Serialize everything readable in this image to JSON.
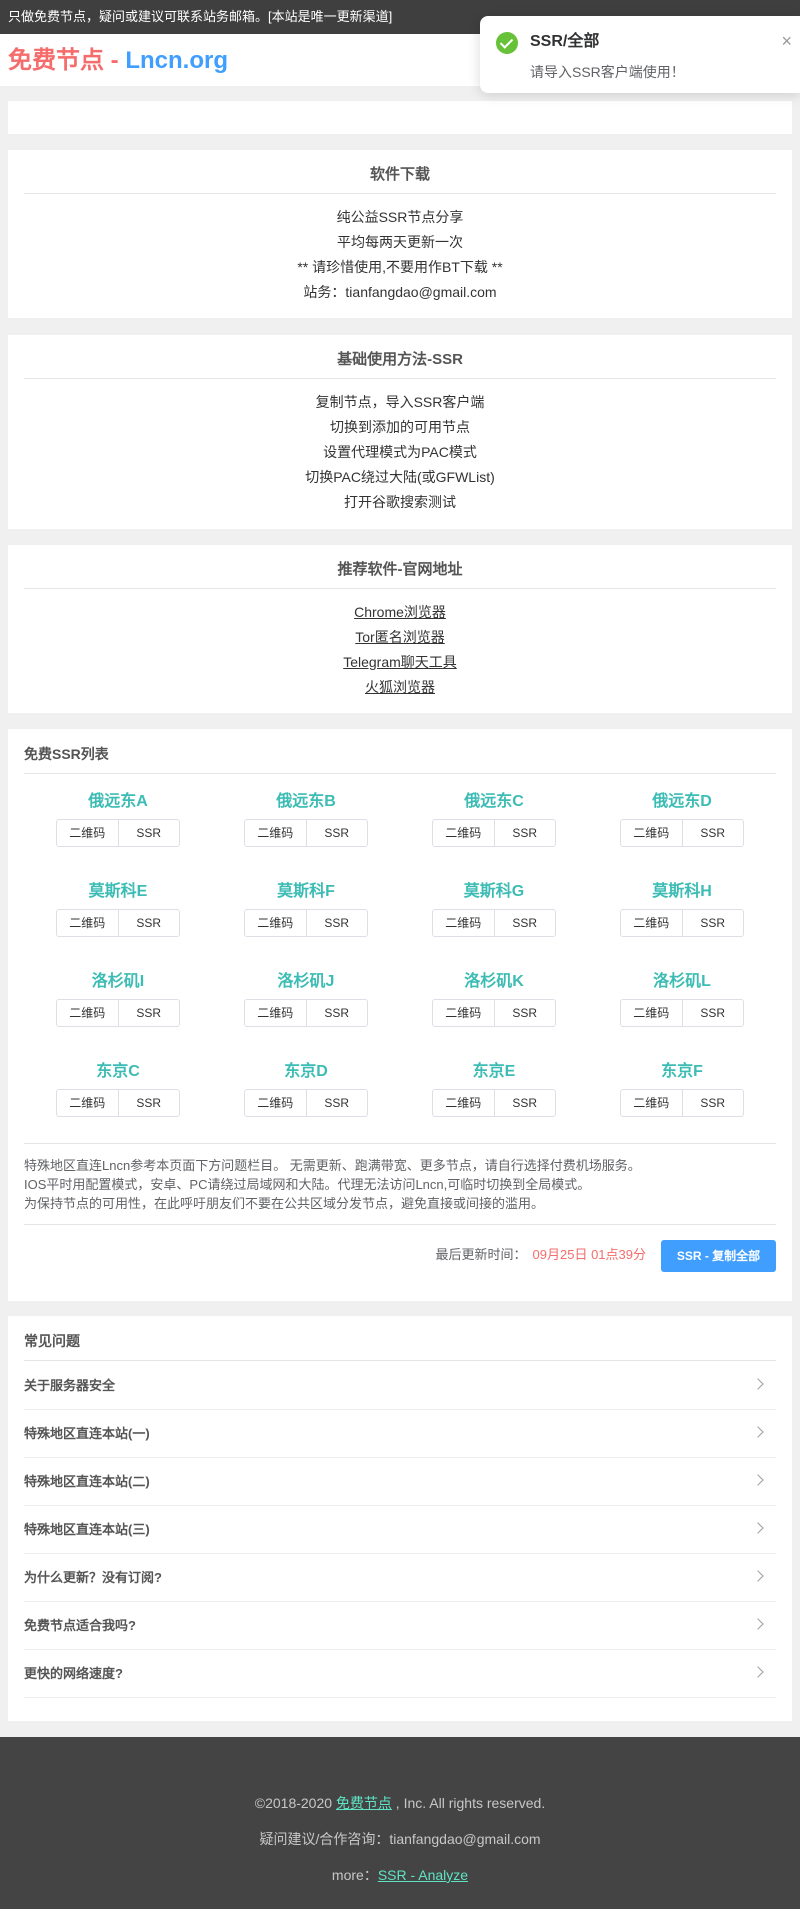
{
  "topbar": {
    "text": "只做免费节点，疑问或建议可联系站务邮箱。[本站是唯一更新渠道]"
  },
  "logo": {
    "part1": "免费节点 - ",
    "part2": "Lncn.org"
  },
  "toast": {
    "title": "SSR/全部",
    "message": "请导入SSR客户端使用！",
    "close": "×"
  },
  "software": {
    "title": "软件下载",
    "lines": [
      "纯公益SSR节点分享",
      "平均每两天更新一次",
      "** 请珍惜使用,不要用作BT下载 **",
      "站务：tianfangdao@gmail.com"
    ]
  },
  "basic": {
    "title": "基础使用方法-SSR",
    "lines": [
      "复制节点，导入SSR客户端",
      "切换到添加的可用节点",
      "设置代理模式为PAC模式",
      "切换PAC绕过大陆(或GFWList)",
      "打开谷歌搜索测试"
    ]
  },
  "recommended": {
    "title": "推荐软件-官网地址",
    "links": [
      "Chrome浏览器",
      "Tor匿名浏览器",
      "Telegram聊天工具",
      "火狐浏览器"
    ]
  },
  "ssr_list": {
    "title": "免费SSR列表",
    "qr_label": "二维码",
    "ssr_label": "SSR",
    "nodes": [
      "俄远东A",
      "俄远东B",
      "俄远东C",
      "俄远东D",
      "莫斯科E",
      "莫斯科F",
      "莫斯科G",
      "莫斯科H",
      "洛杉矶I",
      "洛杉矶J",
      "洛杉矶K",
      "洛杉矶L",
      "东京C",
      "东京D",
      "东京E",
      "东京F"
    ],
    "notice": [
      "特殊地区直连Lncn参考本页面下方问题栏目。 无需更新、跑满带宽、更多节点，请自行选择付费机场服务。",
      "IOS平时用配置模式，安卓、PC请绕过局域网和大陆。代理无法访问Lncn,可临时切换到全局模式。",
      "为保持节点的可用性，在此呼吁朋友们不要在公共区域分发节点，避免直接或间接的滥用。"
    ],
    "updated_label": "最后更新时间：",
    "updated_time": "09月25日 01点39分",
    "copy_all": "SSR - 复制全部"
  },
  "faq": {
    "title": "常见问题",
    "items": [
      "关于服务器安全",
      "特殊地区直连本站(一)",
      "特殊地区直连本站(二)",
      "特殊地区直连本站(三)",
      "为什么更新？没有订阅?",
      "免费节点适合我吗?",
      "更快的网络速度?"
    ]
  },
  "footer": {
    "copyright_prefix": "©2018-2020 ",
    "copyright_link": "免费节点",
    "copyright_suffix": " , Inc. All rights reserved.",
    "contact": "疑问建议/合作咨询：tianfangdao@gmail.com",
    "more_label": "more：",
    "more_link": "SSR - Analyze"
  },
  "colors": {
    "accent": "#409eff",
    "brand_red": "#f56c6c",
    "node_teal": "#3cbcb4",
    "success": "#67c23a"
  }
}
